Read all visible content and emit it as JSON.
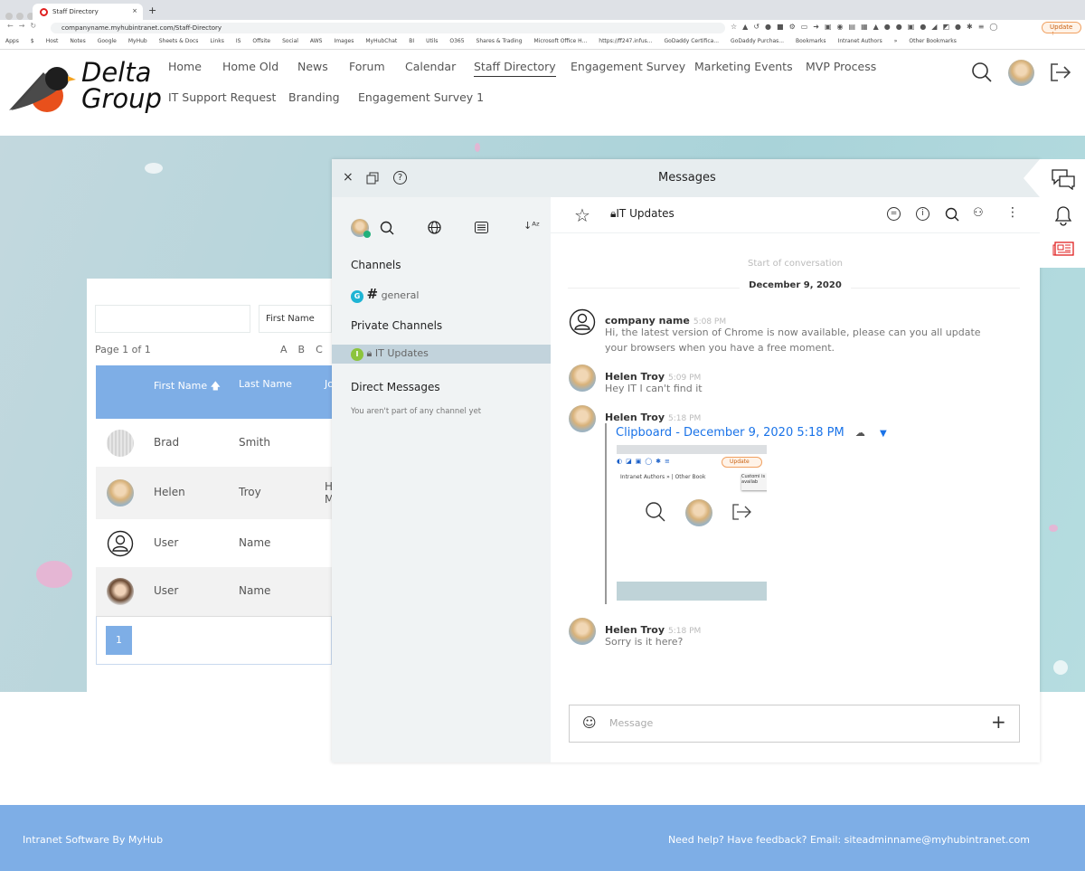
{
  "browser": {
    "tab_title": "Staff Directory",
    "url": "companyname.myhubintranet.com/Staff-Directory",
    "update_label": "Update",
    "bookmarks": [
      "Apps",
      "$",
      "Host",
      "Notes",
      "Google",
      "MyHub",
      "Sheets & Docs",
      "Links",
      "IS",
      "Offsite",
      "Social",
      "AWS",
      "Images",
      "MyHubChat",
      "BI",
      "Utils",
      "O365",
      "Shares & Trading",
      "Microsoft Office H...",
      "https://ff247.infus...",
      "GoDaddy Certifica...",
      "GoDaddy Purchas...",
      "Bookmarks",
      "Intranet Authors",
      "»",
      "Other Bookmarks"
    ]
  },
  "site": {
    "logo_line1": "Delta",
    "logo_line2": "Group",
    "nav_row1": [
      "Home",
      "Home Old",
      "News",
      "Forum",
      "Calendar",
      "Staff Directory",
      "Engagement Survey",
      "Marketing Events",
      "MVP Process"
    ],
    "nav_row2": [
      "IT Support Request",
      "Branding",
      "Engagement Survey 1"
    ],
    "active_nav": "Staff Directory"
  },
  "directory": {
    "search_value": "",
    "sort_value": "First Name",
    "page_info": "Page 1 of 1",
    "letters": [
      "A",
      "B",
      "C"
    ],
    "columns": [
      "First Name",
      "Last Name",
      "Jo"
    ],
    "rows": [
      {
        "first": "Brad",
        "last": "Smith",
        "job": ""
      },
      {
        "first": "Helen",
        "last": "Troy",
        "job": "H\nM"
      },
      {
        "first": "User",
        "last": "Name",
        "job": ""
      },
      {
        "first": "User",
        "last": "Name",
        "job": ""
      }
    ],
    "page_button": "1"
  },
  "messages": {
    "title": "Messages",
    "sidebar": {
      "channels_heading": "Channels",
      "channels": [
        {
          "badge": "G",
          "name": "general",
          "color": "#1eb4d4"
        }
      ],
      "private_heading": "Private Channels",
      "private": [
        {
          "badge": "I",
          "name": "IT Updates",
          "color": "#8cc43c"
        }
      ],
      "dm_heading": "Direct Messages",
      "dm_empty": "You aren't part of any channel yet"
    },
    "channel_title": "IT Updates",
    "start_label": "Start of conversation",
    "date_label": "December 9, 2020",
    "items": [
      {
        "author": "company name",
        "time": "5:08 PM",
        "text": "Hi, the latest version of Chrome is now available, please can you all update your browsers when you have a free moment."
      },
      {
        "author": "Helen Troy",
        "time": "5:09 PM",
        "text": "Hey IT I can't find it"
      },
      {
        "author": "Helen Troy",
        "time": "5:18 PM",
        "attachment": "Clipboard - December 9, 2020 5:18 PM",
        "shot_update": "Update",
        "shot_bm1": "Intranet Authors",
        "shot_bm2": "Other Book",
        "shot_tip": "Customi is availab"
      },
      {
        "author": "Helen Troy",
        "time": "5:18 PM",
        "text": "Sorry is it here?"
      }
    ],
    "composer_placeholder": "Message"
  },
  "footer": {
    "left": "Intranet Software By MyHub",
    "right": "Need help? Have feedback? Email: siteadminname@myhubintranet.com"
  },
  "colors": {
    "accent": "#7eaee6",
    "link": "#1a73e8",
    "logo_orange": "#e8501c"
  }
}
